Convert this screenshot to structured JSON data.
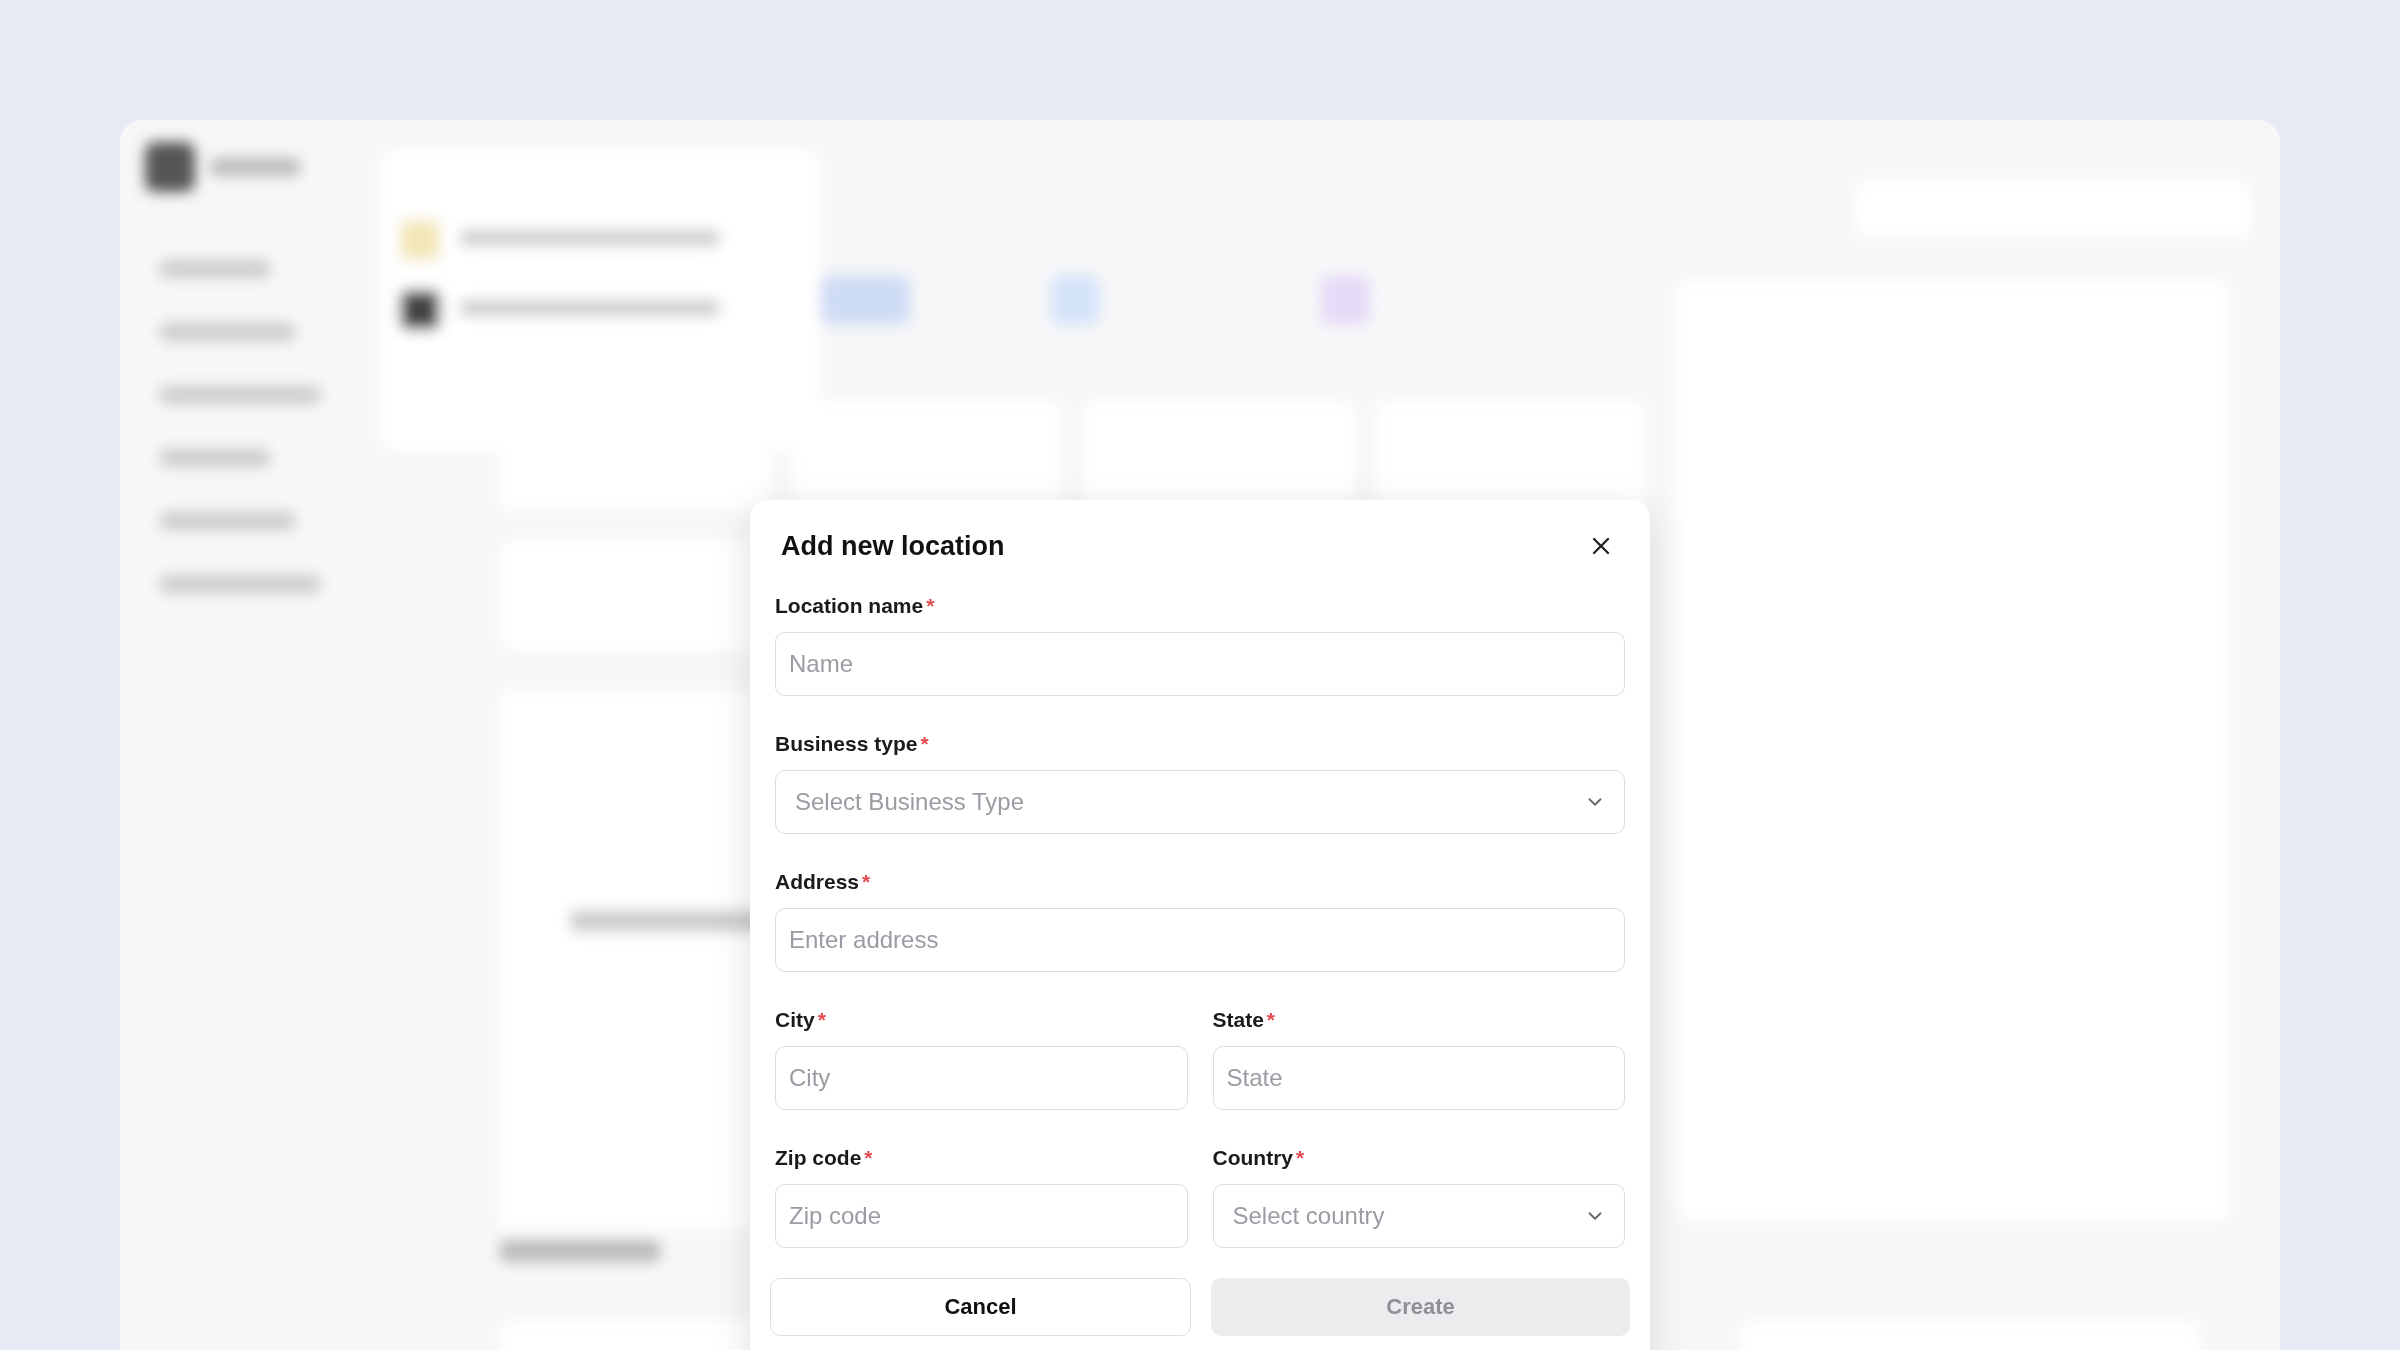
{
  "dialog": {
    "title": "Add new location",
    "required_mark": "*",
    "rows": [
      [
        {
          "label": "Location name",
          "required": true,
          "kind": "text",
          "placeholder": "Name"
        }
      ],
      [
        {
          "label": "Business type",
          "required": true,
          "kind": "select",
          "placeholder": "Select Business Type"
        }
      ],
      [
        {
          "label": "Address",
          "required": true,
          "kind": "text",
          "placeholder": "Enter address"
        }
      ],
      [
        {
          "label": "City",
          "required": true,
          "kind": "text",
          "placeholder": "City"
        },
        {
          "label": "State",
          "required": true,
          "kind": "text",
          "placeholder": "State"
        }
      ],
      [
        {
          "label": "Zip code",
          "required": true,
          "kind": "text",
          "placeholder": "Zip code"
        },
        {
          "label": "Country",
          "required": true,
          "kind": "select",
          "placeholder": "Select country"
        }
      ]
    ],
    "buttons": [
      {
        "label": "Cancel",
        "kind": "secondary",
        "disabled": false
      },
      {
        "label": "Create",
        "kind": "primary",
        "disabled": true
      }
    ]
  }
}
